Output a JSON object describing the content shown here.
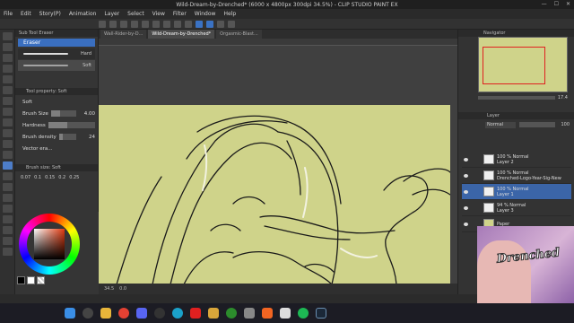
{
  "window": {
    "title": "Wild-Dream-by-Drenched* (6000 x 4800px 300dpi 34.5%) - CLIP STUDIO PAINT EX"
  },
  "menu": [
    "File",
    "Edit",
    "Story(P)",
    "Animation",
    "Layer",
    "Select",
    "View",
    "Filter",
    "Window",
    "Help"
  ],
  "subtool": {
    "header": "Sub Tool Eraser",
    "active_tab": "Eraser",
    "brushes": [
      {
        "label": "Hard",
        "selected": false
      },
      {
        "label": "Soft",
        "selected": true
      }
    ]
  },
  "tool_property": {
    "header": "Tool property: Soft",
    "item_name": "Soft",
    "brush_size_label": "Brush Size",
    "brush_size_value": "4.00",
    "hardness_label": "Hardness",
    "density_label": "Brush density",
    "density_value": "24",
    "vector_label": "Vector era...",
    "density_fraction": 0.24
  },
  "brush_size_panel": {
    "header": "Brush size: Soft",
    "sizes": [
      "0.07",
      "0.1",
      "0.15",
      "0.2",
      "0.25"
    ]
  },
  "colors": {
    "accent": "#3a6fc0",
    "canvas": "#cfd38a",
    "selected_layer": "#3b65a8"
  },
  "canvas": {
    "tabs": [
      {
        "label": "Wall-Rider-by-D...",
        "active": false
      },
      {
        "label": "Wild-Dream-by-Drenched*",
        "active": true
      },
      {
        "label": "Orgasmic-Blast...",
        "active": false
      }
    ],
    "status_zoom": "34.5",
    "status_angle": "0.0"
  },
  "navigator": {
    "header": "Navigator",
    "zoom": "17.4"
  },
  "layer_panel": {
    "header": "Layer",
    "blend_mode": "Normal",
    "opacity": "100",
    "layers": [
      {
        "line1": "100 % Normal",
        "line2": "Layer 2",
        "selected": false,
        "paper": false
      },
      {
        "line1": "100 % Normal",
        "line2": "Drenched-Logo-Year-Sig-New",
        "selected": false,
        "paper": false
      },
      {
        "line1": "100 % Normal",
        "line2": "Layer 1",
        "selected": true,
        "paper": false
      },
      {
        "line1": "94 % Normal",
        "line2": "Layer 3",
        "selected": false,
        "paper": false
      },
      {
        "line1": "",
        "line2": "Paper",
        "selected": false,
        "paper": true
      }
    ]
  },
  "webcam": {
    "logo_text": "Drenched"
  },
  "taskbar": {
    "icons": [
      "start-icon",
      "search-icon",
      "file-explorer-icon",
      "chrome-icon",
      "discord-icon",
      "obs-icon",
      "edge-icon",
      "youtube-icon",
      "folder-icon",
      "xbox-icon",
      "settings-icon",
      "brave-icon",
      "clip-studio-icon",
      "spotify-icon",
      "steam-icon"
    ]
  }
}
